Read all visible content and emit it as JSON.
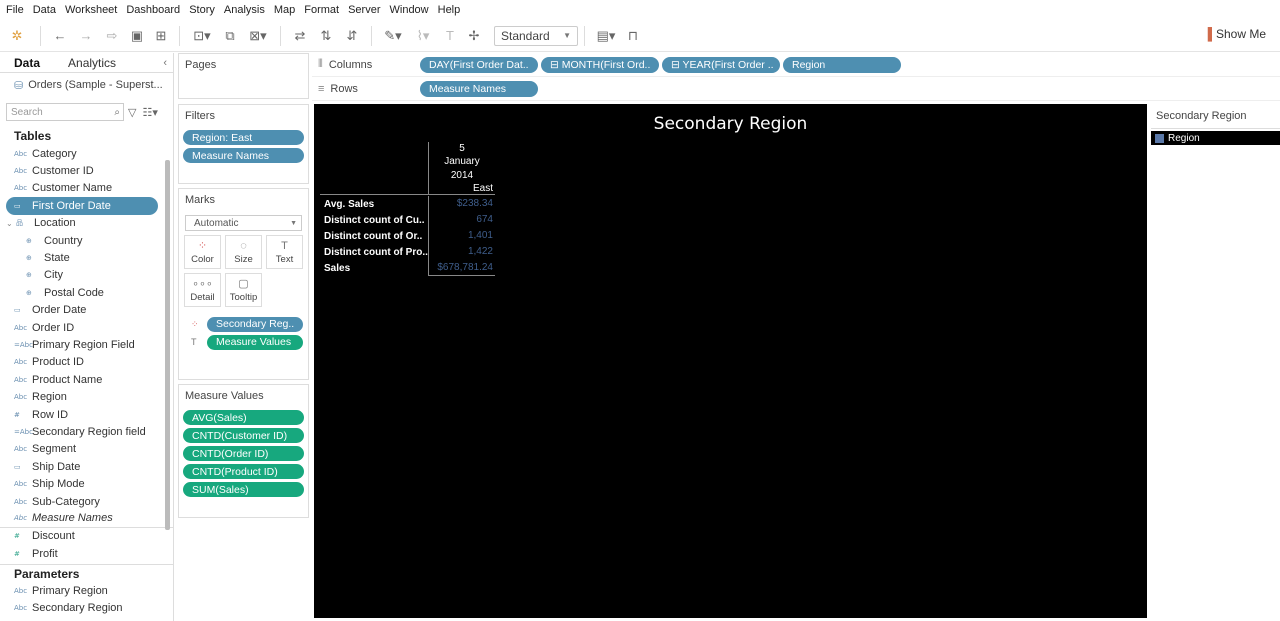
{
  "menu": [
    "File",
    "Data",
    "Worksheet",
    "Dashboard",
    "Story",
    "Analysis",
    "Map",
    "Format",
    "Server",
    "Window",
    "Help"
  ],
  "toolbar": {
    "fit_select": "Standard",
    "show_me": "Show Me"
  },
  "left": {
    "tabs": {
      "data": "Data",
      "analytics": "Analytics"
    },
    "datasource": "Orders (Sample - Superst...",
    "search_placeholder": "Search",
    "tables_title": "Tables",
    "fields": [
      {
        "icon": "Abc",
        "name": "Category"
      },
      {
        "icon": "Abc",
        "name": "Customer ID"
      },
      {
        "icon": "Abc",
        "name": "Customer Name"
      },
      {
        "icon": "▭",
        "name": "First Order Date"
      },
      {
        "icon": "品",
        "name": "Location"
      },
      {
        "icon": "⊕",
        "name": "Country"
      },
      {
        "icon": "⊕",
        "name": "State"
      },
      {
        "icon": "⊕",
        "name": "City"
      },
      {
        "icon": "⊕",
        "name": "Postal Code"
      },
      {
        "icon": "▭",
        "name": "Order Date"
      },
      {
        "icon": "Abc",
        "name": "Order ID"
      },
      {
        "icon": "=Abc",
        "name": "Primary Region Field"
      },
      {
        "icon": "Abc",
        "name": "Product ID"
      },
      {
        "icon": "Abc",
        "name": "Product Name"
      },
      {
        "icon": "Abc",
        "name": "Region"
      },
      {
        "icon": "#",
        "name": "Row ID"
      },
      {
        "icon": "=Abc",
        "name": "Secondary Region field"
      },
      {
        "icon": "Abc",
        "name": "Segment"
      },
      {
        "icon": "▭",
        "name": "Ship Date"
      },
      {
        "icon": "Abc",
        "name": "Ship Mode"
      },
      {
        "icon": "Abc",
        "name": "Sub-Category"
      },
      {
        "icon": "Abc",
        "name": "Measure Names"
      },
      {
        "icon": "#",
        "name": "Discount"
      },
      {
        "icon": "#",
        "name": "Profit"
      }
    ],
    "parameters_title": "Parameters",
    "parameters": [
      {
        "icon": "Abc",
        "name": "Primary Region"
      },
      {
        "icon": "Abc",
        "name": "Secondary Region"
      }
    ]
  },
  "cards": {
    "pages_title": "Pages",
    "filters_title": "Filters",
    "filters": [
      "Region: East",
      "Measure Names"
    ],
    "marks_title": "Marks",
    "marks_type": "Automatic",
    "mark_buttons": [
      {
        "icon": "⁘",
        "label": "Color"
      },
      {
        "icon": "◌",
        "label": "Size"
      },
      {
        "icon": "T",
        "label": "Text"
      },
      {
        "icon": "∘∘∘",
        "label": "Detail"
      },
      {
        "icon": "▢",
        "label": "Tooltip"
      }
    ],
    "mark_pills": [
      "Secondary Reg..",
      "Measure Values"
    ],
    "measure_values_title": "Measure Values",
    "measure_values": [
      "AVG(Sales)",
      "CNTD(Customer ID)",
      "CNTD(Order ID)",
      "CNTD(Product ID)",
      "SUM(Sales)"
    ]
  },
  "shelves": {
    "columns_label": "Columns",
    "columns": [
      "DAY(First Order Dat..",
      "⊟ MONTH(First Ord..",
      "⊟ YEAR(First Order ..",
      "Region"
    ],
    "rows_label": "Rows",
    "rows": [
      "Measure Names"
    ]
  },
  "viz": {
    "title": "Secondary Region",
    "header": {
      "day": "5",
      "month": "January",
      "year": "2014",
      "region": "East"
    },
    "rows": [
      {
        "label": "Avg. Sales",
        "value": "$238.34"
      },
      {
        "label": "Distinct count of Cu..",
        "value": "674"
      },
      {
        "label": "Distinct count of Or..",
        "value": "1,401"
      },
      {
        "label": "Distinct count of Pro..",
        "value": "1,422"
      },
      {
        "label": "Sales",
        "value": "$678,781.24"
      }
    ]
  },
  "legend": {
    "title": "Secondary Region",
    "item": "Region",
    "color": "#5a78a8"
  }
}
